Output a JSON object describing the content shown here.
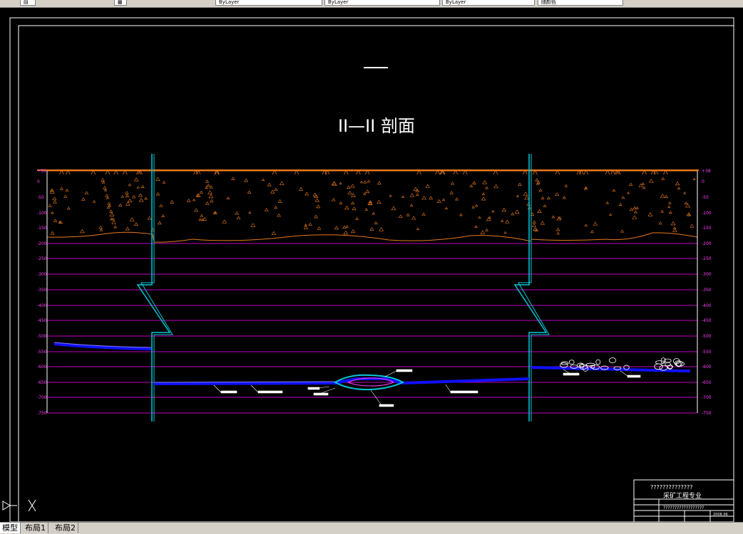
{
  "toolbar": {
    "fields": [
      "ByLayer",
      "ByLayer",
      "ByLayer",
      "随颜色"
    ]
  },
  "drawing": {
    "title": "II—II 剖面",
    "elevation_labels": [
      "+38",
      "0",
      "-50",
      "-100",
      "-150",
      "-200",
      "-250",
      "-300",
      "-350",
      "-400",
      "-450",
      "-500",
      "-550",
      "-600",
      "-650",
      "-700",
      "-750"
    ],
    "title_block": {
      "project": "??????????????",
      "subtitle": "采矿工程专业",
      "row_text": "??????????????????",
      "date": "2008.06"
    }
  },
  "tabs": [
    {
      "label": "模型",
      "active": true
    },
    {
      "label": "布局1",
      "active": false
    },
    {
      "label": "布局2",
      "active": false
    }
  ],
  "colors": {
    "soil": "#e8781c",
    "grid": "#c000c0",
    "shaft": "#00c8d8",
    "seam": "#1010ff",
    "frame": "#ffffff"
  }
}
